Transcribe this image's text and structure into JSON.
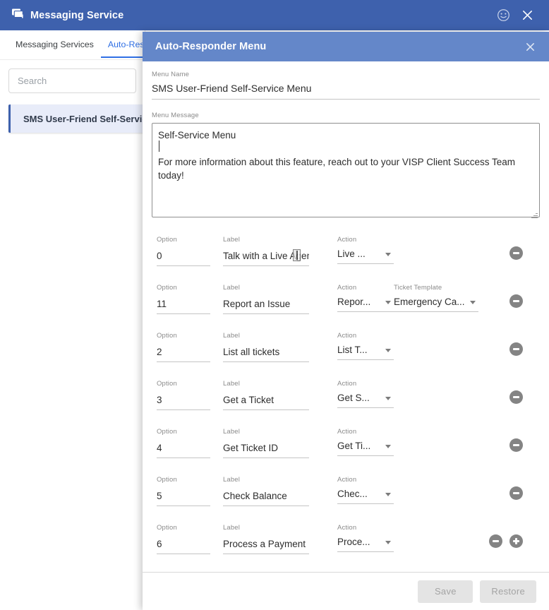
{
  "app": {
    "title": "Messaging Service",
    "icon": "chat-bubbles-icon",
    "header_color": "#3e61ad",
    "smiley_icon": "smiley-face-icon",
    "close_icon": "close-icon"
  },
  "left_panel": {
    "tabs": [
      {
        "label": "Messaging Services",
        "active": false
      },
      {
        "label": "Auto-Responder Menus",
        "active": true
      }
    ],
    "search": {
      "value": "",
      "placeholder": "Search"
    },
    "services": [
      {
        "label": "SMS User-Friend Self-Service Menu",
        "selected": true
      }
    ]
  },
  "dialog": {
    "title": "Auto-Responder Menu",
    "close_icon": "close-icon",
    "header_color": "#6487c9",
    "menu_name": {
      "label": "Menu Name",
      "value": "SMS User-Friend Self-Service Menu"
    },
    "menu_message": {
      "label": "Menu Message",
      "value": "Self-Service Menu\n\nFor more information about this feature, reach out to your VISP Client Success Team today!"
    },
    "column_labels": {
      "option": "Option",
      "label": "Label",
      "action": "Action",
      "ticket_template": "Ticket Template"
    },
    "rows": [
      {
        "option": "0",
        "label": "Talk with a Live Agent",
        "action": "Live ...",
        "ticket_template": null,
        "has_remove": true,
        "has_add": false
      },
      {
        "option": "11",
        "label": "Report an Issue",
        "action": "Repor...",
        "ticket_template": "Emergency Ca...",
        "has_remove": true,
        "has_add": false
      },
      {
        "option": "2",
        "label": "List all tickets",
        "action": "List T...",
        "ticket_template": null,
        "has_remove": true,
        "has_add": false
      },
      {
        "option": "3",
        "label": "Get a Ticket",
        "action": "Get S...",
        "ticket_template": null,
        "has_remove": true,
        "has_add": false
      },
      {
        "option": "4",
        "label": "Get Ticket ID",
        "action": "Get Ti...",
        "ticket_template": null,
        "has_remove": true,
        "has_add": false
      },
      {
        "option": "5",
        "label": "Check Balance",
        "action": "Chec...",
        "ticket_template": null,
        "has_remove": true,
        "has_add": false
      },
      {
        "option": "6",
        "label": "Process a Payment",
        "action": "Proce...",
        "ticket_template": null,
        "has_remove": true,
        "has_add": true
      }
    ],
    "footer": {
      "save_label": "Save",
      "restore_label": "Restore",
      "save_disabled": true,
      "restore_disabled": true
    }
  }
}
